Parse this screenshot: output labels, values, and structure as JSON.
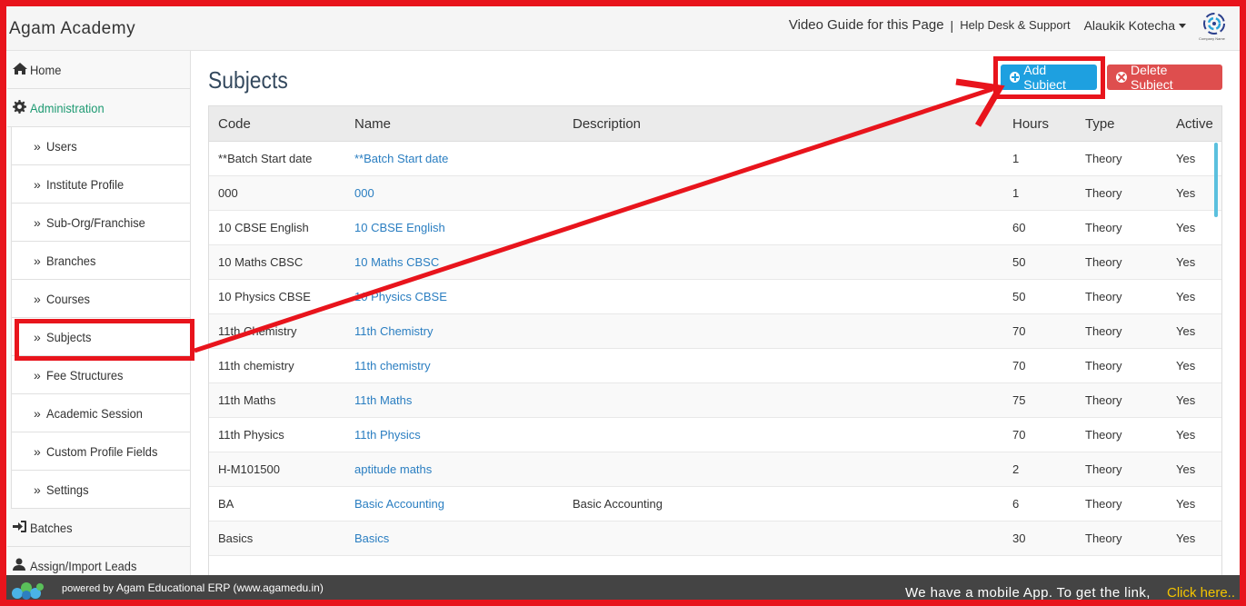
{
  "header": {
    "brand": "Agam Academy",
    "video_guide": "Video Guide for this Page",
    "separator": "|",
    "help_desk": "Help Desk & Support",
    "user_name": "Alaukik Kotecha",
    "logo_text": "Company Name"
  },
  "sidebar": {
    "items": [
      {
        "label": "Home",
        "icon": "home-icon",
        "level": "top"
      },
      {
        "label": "Administration",
        "icon": "gear-icon",
        "level": "top",
        "active": true
      },
      {
        "label": "Users",
        "level": "sub"
      },
      {
        "label": "Institute Profile",
        "level": "sub"
      },
      {
        "label": "Sub-Org/Franchise",
        "level": "sub"
      },
      {
        "label": "Branches",
        "level": "sub"
      },
      {
        "label": "Courses",
        "level": "sub"
      },
      {
        "label": "Subjects",
        "level": "sub",
        "highlighted": true
      },
      {
        "label": "Fee Structures",
        "level": "sub"
      },
      {
        "label": "Academic Session",
        "level": "sub"
      },
      {
        "label": "Custom Profile Fields",
        "level": "sub"
      },
      {
        "label": "Settings",
        "level": "sub"
      },
      {
        "label": "Batches",
        "icon": "sign-in-icon",
        "level": "top"
      },
      {
        "label": "Assign/Import Leads",
        "icon": "user-icon",
        "level": "top"
      }
    ]
  },
  "main": {
    "title": "Subjects",
    "add_button": "Add Subject",
    "delete_button": "Delete Subject"
  },
  "table": {
    "columns": [
      "Code",
      "Name",
      "Description",
      "Hours",
      "Type",
      "Active"
    ],
    "rows": [
      [
        "**Batch Start date",
        "**Batch Start date",
        "",
        "1",
        "Theory",
        "Yes"
      ],
      [
        "000",
        "000",
        "",
        "1",
        "Theory",
        "Yes"
      ],
      [
        "10 CBSE English",
        "10 CBSE English",
        "",
        "60",
        "Theory",
        "Yes"
      ],
      [
        "10 Maths CBSC",
        "10 Maths CBSC",
        "",
        "50",
        "Theory",
        "Yes"
      ],
      [
        "10 Physics CBSE",
        "10 Physics CBSE",
        "",
        "50",
        "Theory",
        "Yes"
      ],
      [
        "11th Chemistry",
        "11th Chemistry",
        "",
        "70",
        "Theory",
        "Yes"
      ],
      [
        "11th chemistry",
        "11th chemistry",
        "",
        "70",
        "Theory",
        "Yes"
      ],
      [
        "11th Maths",
        "11th Maths",
        "",
        "75",
        "Theory",
        "Yes"
      ],
      [
        "11th Physics",
        "11th Physics",
        "",
        "70",
        "Theory",
        "Yes"
      ],
      [
        "H-M101500",
        "aptitude maths",
        "",
        "2",
        "Theory",
        "Yes"
      ],
      [
        "BA",
        "Basic Accounting",
        "Basic Accounting",
        "6",
        "Theory",
        "Yes"
      ],
      [
        "Basics",
        "Basics",
        "",
        "30",
        "Theory",
        "Yes"
      ]
    ]
  },
  "footer": {
    "powered_prefix": "powered by",
    "powered_text": "Agam Educational ERP (www.agamedu.in)",
    "mobile_text": "We have a mobile App. To get the link,",
    "click_here": "Click here.."
  },
  "colors": {
    "annotation": "#e8141c",
    "add_button": "#1ea0e0",
    "delete_button": "#de4e4e",
    "link": "#2a7ec1",
    "active_menu": "#1e9a72"
  }
}
